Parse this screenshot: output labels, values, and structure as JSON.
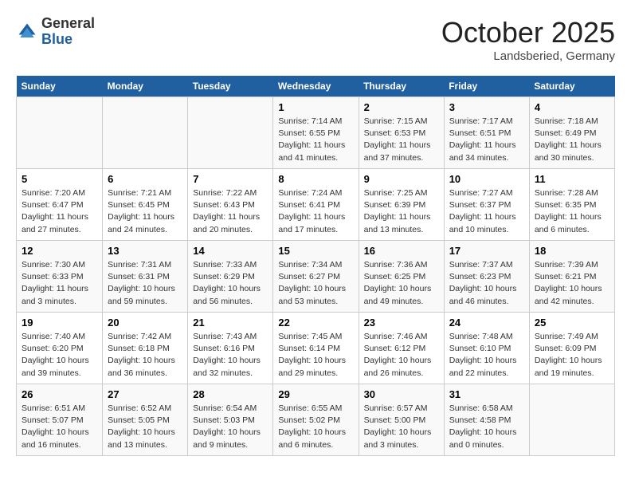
{
  "header": {
    "logo_general": "General",
    "logo_blue": "Blue",
    "month": "October 2025",
    "location": "Landsberied, Germany"
  },
  "days_of_week": [
    "Sunday",
    "Monday",
    "Tuesday",
    "Wednesday",
    "Thursday",
    "Friday",
    "Saturday"
  ],
  "weeks": [
    [
      {
        "day": "",
        "info": ""
      },
      {
        "day": "",
        "info": ""
      },
      {
        "day": "",
        "info": ""
      },
      {
        "day": "1",
        "info": "Sunrise: 7:14 AM\nSunset: 6:55 PM\nDaylight: 11 hours\nand 41 minutes."
      },
      {
        "day": "2",
        "info": "Sunrise: 7:15 AM\nSunset: 6:53 PM\nDaylight: 11 hours\nand 37 minutes."
      },
      {
        "day": "3",
        "info": "Sunrise: 7:17 AM\nSunset: 6:51 PM\nDaylight: 11 hours\nand 34 minutes."
      },
      {
        "day": "4",
        "info": "Sunrise: 7:18 AM\nSunset: 6:49 PM\nDaylight: 11 hours\nand 30 minutes."
      }
    ],
    [
      {
        "day": "5",
        "info": "Sunrise: 7:20 AM\nSunset: 6:47 PM\nDaylight: 11 hours\nand 27 minutes."
      },
      {
        "day": "6",
        "info": "Sunrise: 7:21 AM\nSunset: 6:45 PM\nDaylight: 11 hours\nand 24 minutes."
      },
      {
        "day": "7",
        "info": "Sunrise: 7:22 AM\nSunset: 6:43 PM\nDaylight: 11 hours\nand 20 minutes."
      },
      {
        "day": "8",
        "info": "Sunrise: 7:24 AM\nSunset: 6:41 PM\nDaylight: 11 hours\nand 17 minutes."
      },
      {
        "day": "9",
        "info": "Sunrise: 7:25 AM\nSunset: 6:39 PM\nDaylight: 11 hours\nand 13 minutes."
      },
      {
        "day": "10",
        "info": "Sunrise: 7:27 AM\nSunset: 6:37 PM\nDaylight: 11 hours\nand 10 minutes."
      },
      {
        "day": "11",
        "info": "Sunrise: 7:28 AM\nSunset: 6:35 PM\nDaylight: 11 hours\nand 6 minutes."
      }
    ],
    [
      {
        "day": "12",
        "info": "Sunrise: 7:30 AM\nSunset: 6:33 PM\nDaylight: 11 hours\nand 3 minutes."
      },
      {
        "day": "13",
        "info": "Sunrise: 7:31 AM\nSunset: 6:31 PM\nDaylight: 10 hours\nand 59 minutes."
      },
      {
        "day": "14",
        "info": "Sunrise: 7:33 AM\nSunset: 6:29 PM\nDaylight: 10 hours\nand 56 minutes."
      },
      {
        "day": "15",
        "info": "Sunrise: 7:34 AM\nSunset: 6:27 PM\nDaylight: 10 hours\nand 53 minutes."
      },
      {
        "day": "16",
        "info": "Sunrise: 7:36 AM\nSunset: 6:25 PM\nDaylight: 10 hours\nand 49 minutes."
      },
      {
        "day": "17",
        "info": "Sunrise: 7:37 AM\nSunset: 6:23 PM\nDaylight: 10 hours\nand 46 minutes."
      },
      {
        "day": "18",
        "info": "Sunrise: 7:39 AM\nSunset: 6:21 PM\nDaylight: 10 hours\nand 42 minutes."
      }
    ],
    [
      {
        "day": "19",
        "info": "Sunrise: 7:40 AM\nSunset: 6:20 PM\nDaylight: 10 hours\nand 39 minutes."
      },
      {
        "day": "20",
        "info": "Sunrise: 7:42 AM\nSunset: 6:18 PM\nDaylight: 10 hours\nand 36 minutes."
      },
      {
        "day": "21",
        "info": "Sunrise: 7:43 AM\nSunset: 6:16 PM\nDaylight: 10 hours\nand 32 minutes."
      },
      {
        "day": "22",
        "info": "Sunrise: 7:45 AM\nSunset: 6:14 PM\nDaylight: 10 hours\nand 29 minutes."
      },
      {
        "day": "23",
        "info": "Sunrise: 7:46 AM\nSunset: 6:12 PM\nDaylight: 10 hours\nand 26 minutes."
      },
      {
        "day": "24",
        "info": "Sunrise: 7:48 AM\nSunset: 6:10 PM\nDaylight: 10 hours\nand 22 minutes."
      },
      {
        "day": "25",
        "info": "Sunrise: 7:49 AM\nSunset: 6:09 PM\nDaylight: 10 hours\nand 19 minutes."
      }
    ],
    [
      {
        "day": "26",
        "info": "Sunrise: 6:51 AM\nSunset: 5:07 PM\nDaylight: 10 hours\nand 16 minutes."
      },
      {
        "day": "27",
        "info": "Sunrise: 6:52 AM\nSunset: 5:05 PM\nDaylight: 10 hours\nand 13 minutes."
      },
      {
        "day": "28",
        "info": "Sunrise: 6:54 AM\nSunset: 5:03 PM\nDaylight: 10 hours\nand 9 minutes."
      },
      {
        "day": "29",
        "info": "Sunrise: 6:55 AM\nSunset: 5:02 PM\nDaylight: 10 hours\nand 6 minutes."
      },
      {
        "day": "30",
        "info": "Sunrise: 6:57 AM\nSunset: 5:00 PM\nDaylight: 10 hours\nand 3 minutes."
      },
      {
        "day": "31",
        "info": "Sunrise: 6:58 AM\nSunset: 4:58 PM\nDaylight: 10 hours\nand 0 minutes."
      },
      {
        "day": "",
        "info": ""
      }
    ]
  ]
}
